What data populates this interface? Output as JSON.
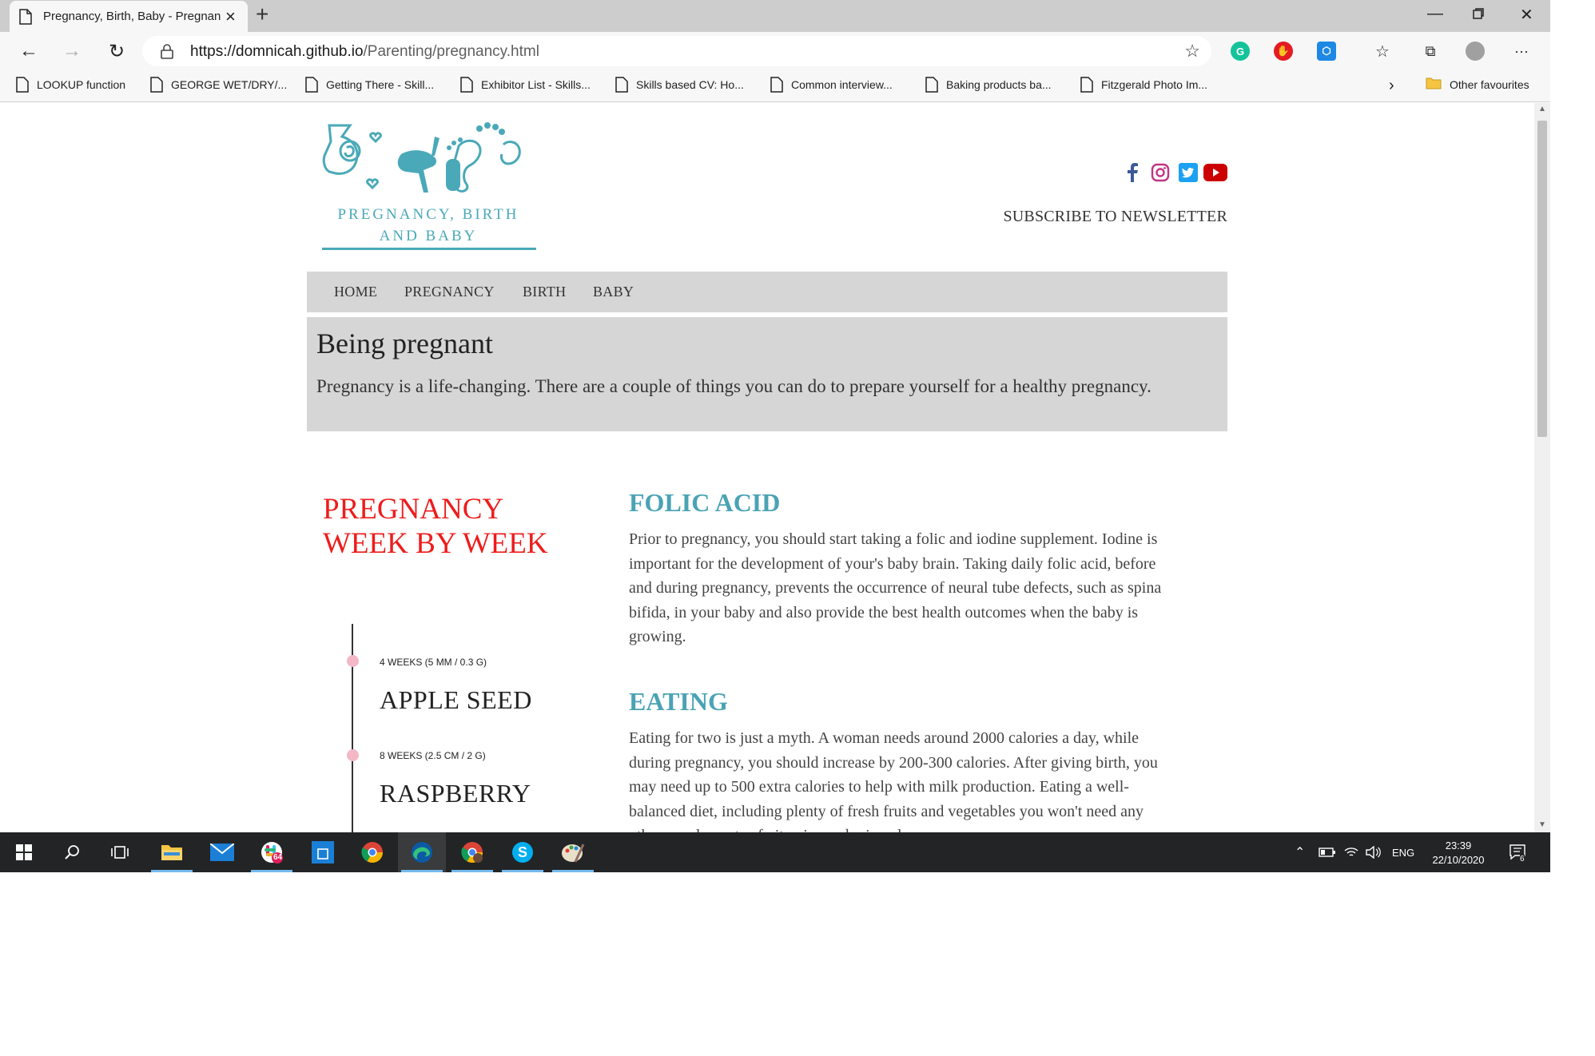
{
  "browser": {
    "tab_title": "Pregnancy, Birth, Baby - Pregnancy",
    "url_host": "https://domnicah.github.io",
    "url_path": "/Parenting/pregnancy.html",
    "favourites": [
      "LOOKUP function",
      "GEORGE WET/DRY/...",
      "Getting There - Skill...",
      "Exhibitor List - Skills...",
      "Skills based CV: Ho...",
      "Common interview...",
      "Baking products ba...",
      "Fitzgerald Photo Im..."
    ],
    "other_favourites": "Other favourites",
    "chevron": "›"
  },
  "page": {
    "logo_text": "PREGNANCY, BIRTH AND BABY",
    "social_icons": [
      "facebook-icon",
      "instagram-icon",
      "twitter-icon",
      "youtube-icon"
    ],
    "subscribe": "SUBSCRIBE TO NEWSLETTER",
    "menu": [
      "HOME",
      "PREGNANCY",
      "BIRTH",
      "BABY"
    ],
    "hero_title": "Being pregnant",
    "hero_text": "Pregnancy is a life-changing. There are a couple of things you can do to prepare yourself for a healthy pregnancy.",
    "week_title": "PREGNANCY WEEK BY WEEK",
    "timeline": [
      {
        "label": "4 WEEKS (5 MM / 0.3 G)",
        "fruit": "APPLE SEED"
      },
      {
        "label": "8 WEEKS (2.5 CM / 2 G)",
        "fruit": "RASPBERRY"
      }
    ],
    "sections": [
      {
        "title": "FOLIC ACID",
        "lines": [
          "Prior to pregnancy, you should start taking a folic and iodine supplement. Iodine is",
          "important for the development of your's baby brain. Taking daily folic acid, before",
          "and during pregnancy, prevents the occurrence of neural tube defects, such as spina",
          "bifida, in your baby and also provide the best health outcomes when the baby is",
          "growing."
        ]
      },
      {
        "title": "EATING",
        "lines": [
          "Eating for two is just a myth. A woman needs around 2000 calories a day, while",
          "during pregnancy, you should increase by 200-300 calories. After giving birth, you",
          "may need up to 500 extra calories to help with milk production. Eating a well-",
          "balanced diet, including plenty of fresh fruits and vegetables you won't need any",
          "other supplements of vitamins and minerals."
        ]
      }
    ],
    "colors": {
      "accent": "#4aa3b4",
      "heading_red": "#ee1c1c",
      "panel": "#d6d6d6"
    }
  },
  "taskbar": {
    "language": "ENG",
    "time": "23:39",
    "date": "22/10/2020",
    "notification_count": "6",
    "slack_badge": "64"
  }
}
